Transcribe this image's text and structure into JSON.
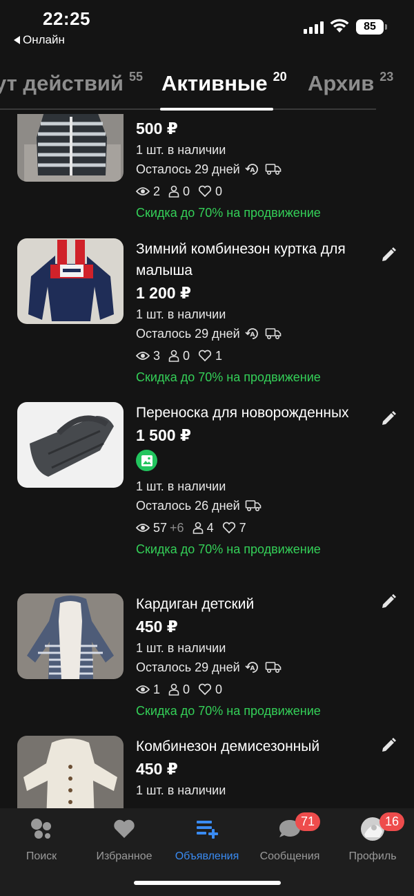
{
  "status_bar": {
    "time": "22:25",
    "back_app": "Онлайн",
    "battery": "85"
  },
  "tabs": [
    {
      "label": "ут действий",
      "count": "55"
    },
    {
      "label": "Активные",
      "count": "20"
    },
    {
      "label": "Архив",
      "count": "23"
    }
  ],
  "listings": [
    {
      "title": "",
      "price": "500 ₽",
      "stock": "1 шт. в наличии",
      "remaining": "Осталось 29 дней",
      "views": "2",
      "views_plus": "",
      "contacts": "0",
      "favorites": "0",
      "promo": "Скидка до 70% на продвижение"
    },
    {
      "title": "Зимний комбинезон куртка для малыша",
      "price": "1 200 ₽",
      "stock": "1 шт. в наличии",
      "remaining": "Осталось 29 дней",
      "views": "3",
      "views_plus": "",
      "contacts": "0",
      "favorites": "1",
      "promo": "Скидка до 70% на продвижение"
    },
    {
      "title": "Переноска для новорожденных",
      "price": "1 500 ₽",
      "stock": "1 шт. в наличии",
      "remaining": "Осталось 26 дней",
      "views": "57",
      "views_plus": "+6",
      "contacts": "4",
      "favorites": "7",
      "promo": "Скидка до 70% на продвижение"
    },
    {
      "title": "Кардиган детский",
      "price": "450 ₽",
      "stock": "1 шт. в наличии",
      "remaining": "Осталось 29 дней",
      "views": "1",
      "views_plus": "",
      "contacts": "0",
      "favorites": "0",
      "promo": "Скидка до 70% на продвижение"
    },
    {
      "title": "Комбинезон демисезонный",
      "price": "450 ₽",
      "stock": "1 шт. в наличии",
      "remaining": "",
      "views": "",
      "views_plus": "",
      "contacts": "",
      "favorites": "",
      "promo": ""
    }
  ],
  "bottom_nav": [
    {
      "label": "Поиск",
      "icon": "search-dots-icon"
    },
    {
      "label": "Избранное",
      "icon": "heart-icon"
    },
    {
      "label": "Объявления",
      "icon": "listings-add-icon"
    },
    {
      "label": "Сообщения",
      "icon": "chat-bubble-icon",
      "badge": "71"
    },
    {
      "label": "Профиль",
      "icon": "avatar",
      "badge": "16"
    }
  ],
  "colors": {
    "background": "#141414",
    "promo_green": "#34d058",
    "active_blue": "#3a8bf2",
    "badge_red": "#ee4c4c",
    "nav_bg": "#1e1e1e"
  }
}
